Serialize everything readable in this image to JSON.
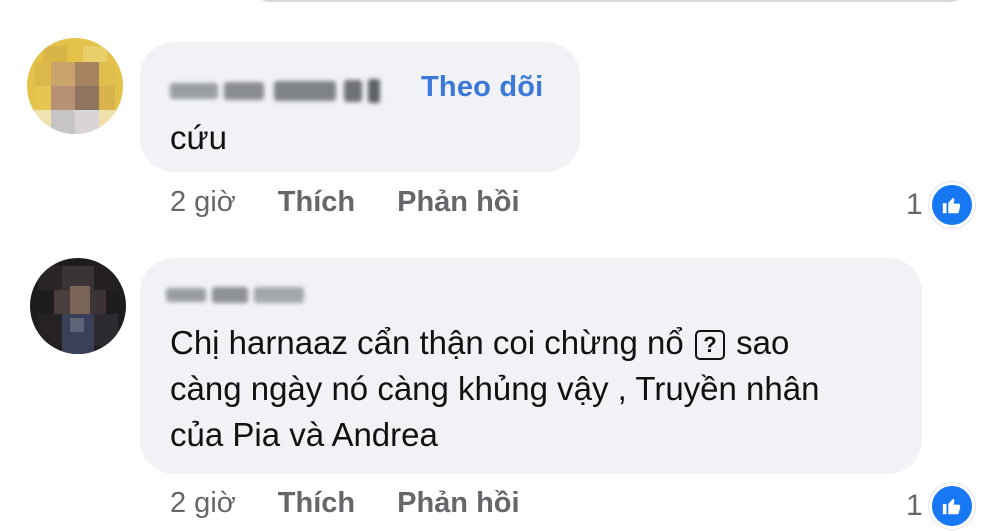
{
  "comments": [
    {
      "follow_label": "Theo dõi",
      "text_lines": [
        "cứu"
      ],
      "time": "2 giờ",
      "like_label": "Thích",
      "reply_label": "Phản hồi",
      "reaction_count": "1",
      "reaction_icon": "like-icon"
    },
    {
      "text_line1_before": "Chị harnaaz cẩn thận coi chừng nổ",
      "text_line1_box": "?",
      "text_line1_after": "sao",
      "text_line2": "càng ngày nó càng khủng vậy , Truyền nhân",
      "text_line3": "của Pia và Andrea",
      "time": "2 giờ",
      "like_label": "Thích",
      "reply_label": "Phản hồi",
      "reaction_count": "1",
      "reaction_icon": "like-icon"
    }
  ],
  "colors": {
    "bubble": "#f0f2f5",
    "follow": "#3b78d8",
    "action_text": "#65676b",
    "like_blue": "#1877f2"
  }
}
